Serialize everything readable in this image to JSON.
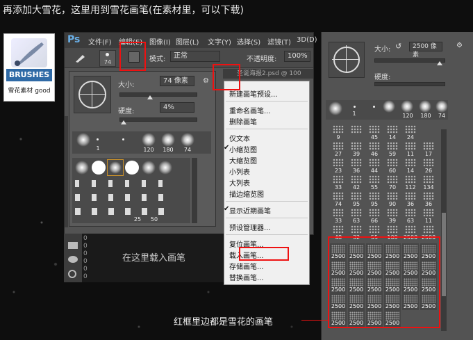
{
  "caption": "再添加大雪花，这里用到雪花画笔(在素材里，可以下载)",
  "logo": {
    "label": "BRUSHES",
    "sub": "雪花素材 good"
  },
  "ps": {
    "app_icon": "Ps",
    "menu": [
      "文件(F)",
      "编辑(E)",
      "图像(I)",
      "图层(L)",
      "文字(Y)",
      "选择(S)",
      "滤镜(T)",
      "3D(D)"
    ],
    "options": {
      "brush_size": "74",
      "mode_label": "模式:",
      "mode_value": "正常",
      "opacity_label": "不透明度:",
      "opacity_value": "100%"
    },
    "doc_tab": "圣诞海报2.psd @ 100",
    "panel": {
      "size_label": "大小:",
      "size_value": "74 像素",
      "hardness_label": "硬度:",
      "hardness_value": "4%",
      "recent_sizes": [
        "1",
        "120",
        "180",
        "74"
      ],
      "grid_labels": [
        "25",
        "50"
      ]
    },
    "ruler_digits": [
      "0",
      "0",
      "0",
      "0",
      "0",
      "0"
    ]
  },
  "menu_items": [
    "新建画笔预设...",
    "重命名画笔...",
    "删除画笔",
    "仅文本",
    "小缩览图",
    "大缩览图",
    "小列表",
    "大列表",
    "描边缩览图",
    "显示近期画笔",
    "预设管理器...",
    "复位画笔...",
    "载入画笔...",
    "存储画笔...",
    "替换画笔..."
  ],
  "menu_checked": [
    "小缩览图",
    "显示近期画笔"
  ],
  "load_label": "在这里载入画笔",
  "right_panel": {
    "size_label": "大小:",
    "size_value": "2500 像素",
    "hardness_label": "硬度:",
    "recent_sizes": [
      "1",
      "120",
      "180",
      "74"
    ],
    "rows": [
      [
        "9",
        "",
        "45",
        "14",
        "24"
      ],
      [
        "27",
        "39",
        "46",
        "59",
        "11",
        "17"
      ],
      [
        "23",
        "36",
        "44",
        "60",
        "14",
        "26"
      ],
      [
        "33",
        "42",
        "55",
        "70",
        "112",
        "134"
      ],
      [
        "74",
        "95",
        "95",
        "90",
        "36",
        "36"
      ],
      [
        "33",
        "63",
        "66",
        "39",
        "63",
        "11"
      ],
      [
        "48",
        "32",
        "55",
        "100",
        "2500",
        "2500"
      ]
    ],
    "snow_rows": [
      [
        "2500",
        "2500",
        "2500",
        "2500",
        "2500",
        "2500"
      ],
      [
        "2500",
        "2500",
        "2500",
        "2500",
        "2500",
        "2500"
      ],
      [
        "2500",
        "2500",
        "2500",
        "2500",
        "2500",
        "2500"
      ],
      [
        "2500",
        "2500",
        "2500",
        "2500",
        "2500",
        "2500"
      ],
      [
        "2500",
        "2500",
        "2500",
        "2500"
      ]
    ]
  },
  "annotation": "红框里边都是雪花的画笔",
  "colors": {
    "highlight": "#e11111",
    "panel": "#535353",
    "menubar": "#3c3c3c"
  }
}
